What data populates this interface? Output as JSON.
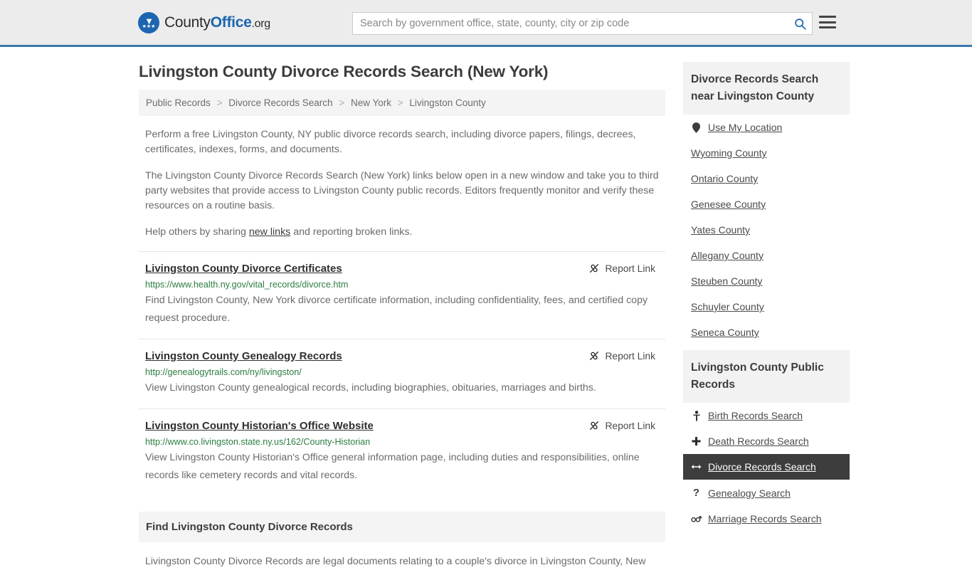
{
  "header": {
    "brand": {
      "part1": "County",
      "part2": "Office",
      "part3": ".org",
      "logo_icon": "eagle-shield-logo",
      "eagle_glyph": "▼",
      "stars_glyph": "★★★"
    },
    "search": {
      "placeholder": "Search by government office, state, county, city or zip code",
      "value": "",
      "search_icon": "magnifier-icon"
    },
    "menu_icon": "hamburger-menu-icon"
  },
  "main": {
    "title": "Livingston County Divorce Records Search (New York)",
    "breadcrumb": {
      "items": [
        {
          "label": "Public Records"
        },
        {
          "label": "Divorce Records Search"
        },
        {
          "label": "New York"
        },
        {
          "label": "Livingston County"
        }
      ],
      "separator": ">"
    },
    "intro": {
      "p1": "Perform a free Livingston County, NY public divorce records search, including divorce papers, filings, decrees, certificates, indexes, forms, and documents.",
      "p2": "The Livingston County Divorce Records Search (New York) links below open in a new window and take you to third party websites that provide access to Livingston County public records. Editors frequently monitor and verify these resources on a routine basis.",
      "p3_before": "Help others by sharing ",
      "p3_link": "new links",
      "p3_after": " and reporting broken links."
    },
    "report_link_label": "Report Link",
    "report_link_icon": "broken-link-icon",
    "results": [
      {
        "title": "Livingston County Divorce Certificates",
        "url": "https://www.health.ny.gov/vital_records/divorce.htm",
        "description": "Find Livingston County, New York divorce certificate information, including confidentiality, fees, and certified copy request procedure."
      },
      {
        "title": "Livingston County Genealogy Records",
        "url": "http://genealogytrails.com/ny/livingston/",
        "description": "View Livingston County genealogical records, including biographies, obituaries, marriages and births."
      },
      {
        "title": "Livingston County Historian's Office Website",
        "url": "http://www.co.livingston.state.ny.us/162/County-Historian",
        "description": "View Livingston County Historian's Office general information page, including duties and responsibilities, online records like cemetery records and vital records."
      }
    ],
    "bottom_section": {
      "heading": "Find Livingston County Divorce Records",
      "paragraph": "Livingston County Divorce Records are legal documents relating to a couple's divorce in Livingston County, New"
    }
  },
  "sidebar": {
    "nearby": {
      "heading": "Divorce Records Search near Livingston County",
      "use_my_location": {
        "label": "Use My Location",
        "icon": "map-pin-icon"
      },
      "counties": [
        {
          "label": "Wyoming County"
        },
        {
          "label": "Ontario County"
        },
        {
          "label": "Genesee County"
        },
        {
          "label": "Yates County"
        },
        {
          "label": "Allegany County"
        },
        {
          "label": "Steuben County"
        },
        {
          "label": "Schuyler County"
        },
        {
          "label": "Seneca County"
        }
      ]
    },
    "public_records": {
      "heading": "Livingston County Public Records",
      "items": [
        {
          "label": "Birth Records Search",
          "icon": "baby-icon",
          "glyph": "👶",
          "active": false
        },
        {
          "label": "Death Records Search",
          "icon": "cross-icon",
          "glyph": "✚",
          "active": false
        },
        {
          "label": "Divorce Records Search",
          "icon": "split-arrows-icon",
          "glyph": "↔",
          "active": true
        },
        {
          "label": "Genealogy Search",
          "icon": "question-mark-icon",
          "glyph": "?",
          "active": false
        },
        {
          "label": "Marriage Records Search",
          "icon": "male-female-icon",
          "glyph": "⚥",
          "active": false
        }
      ]
    }
  },
  "colors": {
    "header_bg": "#ececec",
    "header_border": "#3d78ad",
    "brand_blue": "#1c65b0",
    "url_green": "#2c7d41",
    "active_bg": "#3d3d3d",
    "panel_gray": "#f2f2f2"
  }
}
